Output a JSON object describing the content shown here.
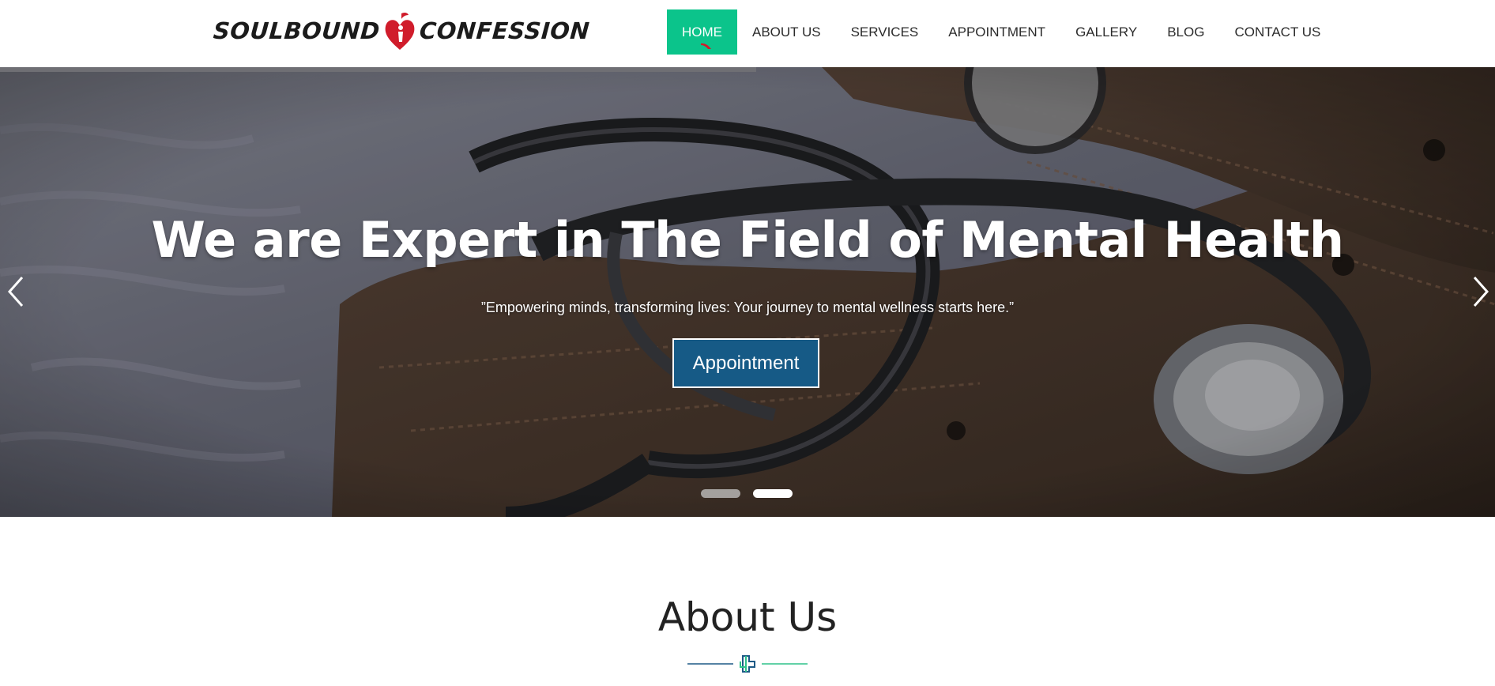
{
  "brand": {
    "name_left": "SOULBOUND",
    "name_right": "CONFESSION",
    "heart_color": "#d01c2b"
  },
  "nav": {
    "items": [
      {
        "label": "HOME",
        "active": true
      },
      {
        "label": "ABOUT US"
      },
      {
        "label": "SERVICES"
      },
      {
        "label": "APPOINTMENT"
      },
      {
        "label": "GALLERY"
      },
      {
        "label": "BLOG"
      },
      {
        "label": "CONTACT US"
      }
    ],
    "active_color": "#0bc48b"
  },
  "hero": {
    "title": "We are Expert in The Field of Mental Health",
    "quote": "”Empowering minds, transforming lives: Your journey to mental wellness starts here.”",
    "button_label": "Appointment",
    "button_color": "#165a86",
    "prev_icon": "chevron-left-icon",
    "next_icon": "chevron-right-icon",
    "slides_total": 2,
    "active_slide": 2
  },
  "about": {
    "title": "About Us",
    "divider_icon": "medical-cross-icon"
  }
}
